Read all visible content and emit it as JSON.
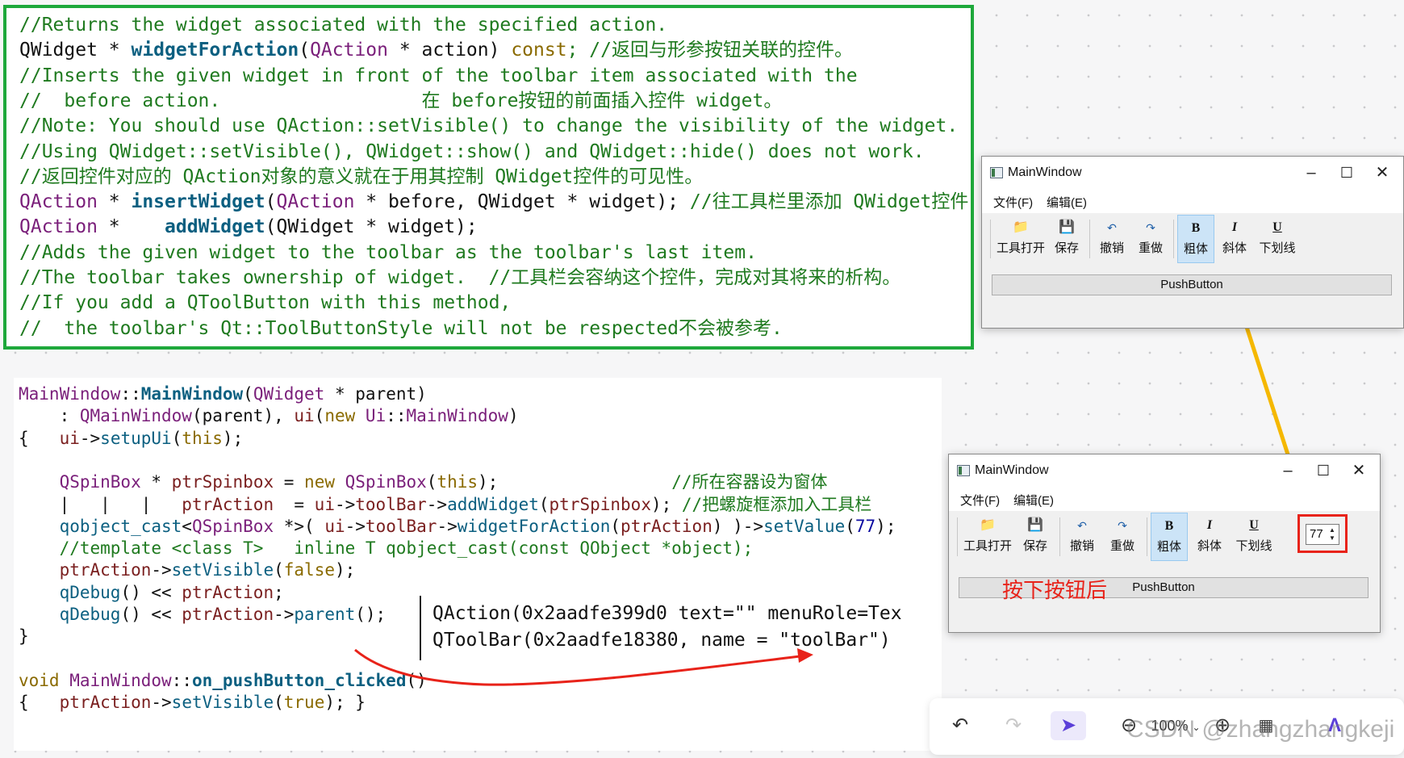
{
  "doc_lines": [
    [
      {
        "t": "//Returns the widget associated with the specified action.",
        "c": "cm"
      }
    ],
    [
      {
        "t": "QWidget ",
        "c": "tx"
      },
      {
        "t": "* ",
        "c": "tx"
      },
      {
        "t": "widgetForAction",
        "c": "fn"
      },
      {
        "t": "(",
        "c": "tx"
      },
      {
        "t": "QAction",
        "c": "ty"
      },
      {
        "t": " * action) ",
        "c": "tx"
      },
      {
        "t": "const",
        "c": "kw"
      },
      {
        "t": "; //返回与形参按钮关联的控件。",
        "c": "cm"
      }
    ],
    [
      {
        "t": "//Inserts the given widget in front of the toolbar item associated with the",
        "c": "cm"
      }
    ],
    [
      {
        "t": "//  before action.                  在 before按钮的前面插入控件 widget。",
        "c": "cm"
      }
    ],
    [
      {
        "t": "//Note: You should use QAction::setVisible() to change the visibility of the widget.",
        "c": "cm"
      }
    ],
    [
      {
        "t": "//Using QWidget::setVisible(), QWidget::show() and QWidget::hide() does not work.",
        "c": "cm"
      }
    ],
    [
      {
        "t": "//返回控件对应的 QAction对象的意义就在于用其控制 QWidget控件的可见性。",
        "c": "cm"
      }
    ],
    [
      {
        "t": "QAction",
        "c": "ty"
      },
      {
        "t": " * ",
        "c": "tx"
      },
      {
        "t": "insertWidget",
        "c": "fn"
      },
      {
        "t": "(",
        "c": "tx"
      },
      {
        "t": "QAction",
        "c": "ty"
      },
      {
        "t": " * before, QWidget * widget); ",
        "c": "tx"
      },
      {
        "t": "//往工具栏里添加 QWidget控件",
        "c": "cm"
      }
    ],
    [
      {
        "t": "QAction",
        "c": "ty"
      },
      {
        "t": " *    ",
        "c": "tx"
      },
      {
        "t": "addWidget",
        "c": "fn"
      },
      {
        "t": "(QWidget * widget);",
        "c": "tx"
      }
    ],
    [
      {
        "t": "//Adds the given widget to the toolbar as the toolbar's last item.",
        "c": "cm"
      }
    ],
    [
      {
        "t": "//The toolbar takes ownership of widget.  //工具栏会容纳这个控件，完成对其将来的析构。",
        "c": "cm"
      }
    ],
    [
      {
        "t": "//If you add a QToolButton with this method,",
        "c": "cm"
      }
    ],
    [
      {
        "t": "//  the toolbar's Qt::ToolButtonStyle will not be respected不会被参考.",
        "c": "cm"
      }
    ]
  ],
  "code_lines": [
    [
      {
        "t": "MainWindow",
        "c": "c-ty"
      },
      {
        "t": "::",
        "c": ""
      },
      {
        "t": "MainWindow",
        "c": "c-fn"
      },
      {
        "t": "(",
        "c": ""
      },
      {
        "t": "QWidget",
        "c": "c-ty"
      },
      {
        "t": " * ",
        "c": ""
      },
      {
        "t": "parent",
        "c": ""
      },
      {
        "t": ")",
        "c": ""
      }
    ],
    [
      {
        "t": "    : ",
        "c": ""
      },
      {
        "t": "QMainWindow",
        "c": "c-ty"
      },
      {
        "t": "(parent), ",
        "c": ""
      },
      {
        "t": "ui",
        "c": "c-var"
      },
      {
        "t": "(",
        "c": ""
      },
      {
        "t": "new",
        "c": "c-kw"
      },
      {
        "t": " ",
        "c": ""
      },
      {
        "t": "Ui",
        "c": "c-ty"
      },
      {
        "t": "::",
        "c": ""
      },
      {
        "t": "MainWindow",
        "c": "c-ty"
      },
      {
        "t": ")",
        "c": ""
      }
    ],
    [
      {
        "t": "{   ",
        "c": ""
      },
      {
        "t": "ui",
        "c": "c-var"
      },
      {
        "t": "->",
        "c": ""
      },
      {
        "t": "setupUi",
        "c": "c-fnn"
      },
      {
        "t": "(",
        "c": ""
      },
      {
        "t": "this",
        "c": "c-kw"
      },
      {
        "t": ");",
        "c": ""
      }
    ],
    [
      {
        "t": "",
        "c": ""
      }
    ],
    [
      {
        "t": "    ",
        "c": ""
      },
      {
        "t": "QSpinBox",
        "c": "c-ty"
      },
      {
        "t": " * ",
        "c": ""
      },
      {
        "t": "ptrSpinbox",
        "c": "c-var"
      },
      {
        "t": " = ",
        "c": ""
      },
      {
        "t": "new",
        "c": "c-kw"
      },
      {
        "t": " ",
        "c": ""
      },
      {
        "t": "QSpinBox",
        "c": "c-ty"
      },
      {
        "t": "(",
        "c": ""
      },
      {
        "t": "this",
        "c": "c-kw"
      },
      {
        "t": ");                 ",
        "c": ""
      },
      {
        "t": "//所在容器设为窗体",
        "c": "c-cm"
      }
    ],
    [
      {
        "t": "    |   |   |   ",
        "c": ""
      },
      {
        "t": "ptrAction",
        "c": "c-var"
      },
      {
        "t": "  = ",
        "c": ""
      },
      {
        "t": "ui",
        "c": "c-var"
      },
      {
        "t": "->",
        "c": ""
      },
      {
        "t": "toolBar",
        "c": "c-var"
      },
      {
        "t": "->",
        "c": ""
      },
      {
        "t": "addWidget",
        "c": "c-fnn"
      },
      {
        "t": "(",
        "c": ""
      },
      {
        "t": "ptrSpinbox",
        "c": "c-var"
      },
      {
        "t": "); ",
        "c": ""
      },
      {
        "t": "//把螺旋框添加入工具栏",
        "c": "c-cm"
      }
    ],
    [
      {
        "t": "    ",
        "c": ""
      },
      {
        "t": "qobject_cast",
        "c": "c-fnn"
      },
      {
        "t": "<",
        "c": ""
      },
      {
        "t": "QSpinBox",
        "c": "c-ty"
      },
      {
        "t": " *>( ",
        "c": ""
      },
      {
        "t": "ui",
        "c": "c-var"
      },
      {
        "t": "->",
        "c": ""
      },
      {
        "t": "toolBar",
        "c": "c-var"
      },
      {
        "t": "->",
        "c": ""
      },
      {
        "t": "widgetForAction",
        "c": "c-fnn"
      },
      {
        "t": "(",
        "c": ""
      },
      {
        "t": "ptrAction",
        "c": "c-var"
      },
      {
        "t": ") )->",
        "c": ""
      },
      {
        "t": "setValue",
        "c": "c-fnn"
      },
      {
        "t": "(",
        "c": ""
      },
      {
        "t": "77",
        "c": "c-num"
      },
      {
        "t": ");",
        "c": ""
      }
    ],
    [
      {
        "t": "    ",
        "c": ""
      },
      {
        "t": "//template <class T>   inline T qobject_cast(const QObject *object);",
        "c": "c-cm"
      }
    ],
    [
      {
        "t": "    ",
        "c": ""
      },
      {
        "t": "ptrAction",
        "c": "c-var"
      },
      {
        "t": "->",
        "c": ""
      },
      {
        "t": "setVisible",
        "c": "c-fnn"
      },
      {
        "t": "(",
        "c": ""
      },
      {
        "t": "false",
        "c": "c-kw"
      },
      {
        "t": ");",
        "c": ""
      }
    ],
    [
      {
        "t": "    ",
        "c": ""
      },
      {
        "t": "qDebug",
        "c": "c-fnn"
      },
      {
        "t": "() << ",
        "c": ""
      },
      {
        "t": "ptrAction",
        "c": "c-var"
      },
      {
        "t": ";",
        "c": ""
      }
    ],
    [
      {
        "t": "    ",
        "c": ""
      },
      {
        "t": "qDebug",
        "c": "c-fnn"
      },
      {
        "t": "() << ",
        "c": ""
      },
      {
        "t": "ptrAction",
        "c": "c-var"
      },
      {
        "t": "->",
        "c": ""
      },
      {
        "t": "parent",
        "c": "c-fnn"
      },
      {
        "t": "();",
        "c": ""
      }
    ],
    [
      {
        "t": "}",
        "c": ""
      }
    ],
    [
      {
        "t": "",
        "c": ""
      }
    ],
    [
      {
        "t": "void",
        "c": "c-kw"
      },
      {
        "t": " ",
        "c": ""
      },
      {
        "t": "MainWindow",
        "c": "c-ty"
      },
      {
        "t": "::",
        "c": ""
      },
      {
        "t": "on_pushButton_clicked",
        "c": "c-fn"
      },
      {
        "t": "()",
        "c": ""
      }
    ],
    [
      {
        "t": "{   ",
        "c": ""
      },
      {
        "t": "ptrAction",
        "c": "c-var"
      },
      {
        "t": "->",
        "c": ""
      },
      {
        "t": "setVisible",
        "c": "c-fnn"
      },
      {
        "t": "(",
        "c": ""
      },
      {
        "t": "true",
        "c": "c-kw"
      },
      {
        "t": "); }",
        "c": ""
      }
    ]
  ],
  "output": {
    "line1": "QAction(0x2aadfe399d0 text=\"\" menuRole=Tex",
    "line2": "QToolBar(0x2aadfe18380, name = \"toolBar\")"
  },
  "window1": {
    "title": "MainWindow",
    "menus": [
      "文件(F)",
      "编辑(E)"
    ],
    "tools": [
      {
        "label": "工具打开",
        "icon": "folder-icon"
      },
      {
        "label": "保存",
        "icon": "save-icon"
      },
      {
        "label": "撤销",
        "icon": "undo-icon"
      },
      {
        "label": "重做",
        "icon": "redo-icon"
      },
      {
        "label": "粗体",
        "icon": "bold-icon"
      },
      {
        "label": "斜体",
        "icon": "italic-icon"
      },
      {
        "label": "下划线",
        "icon": "underline-icon"
      }
    ],
    "push_button": "PushButton"
  },
  "window2": {
    "title": "MainWindow",
    "menus": [
      "文件(F)",
      "编辑(E)"
    ],
    "tools": [
      {
        "label": "工具打开",
        "icon": "folder-icon"
      },
      {
        "label": "保存",
        "icon": "save-icon"
      },
      {
        "label": "撤销",
        "icon": "undo-icon"
      },
      {
        "label": "重做",
        "icon": "redo-icon"
      },
      {
        "label": "粗体",
        "icon": "bold-icon"
      },
      {
        "label": "斜体",
        "icon": "italic-icon"
      },
      {
        "label": "下划线",
        "icon": "underline-icon"
      }
    ],
    "spin_value": "77",
    "annotation": "按下按钮后",
    "push_button": "PushButton"
  },
  "canvas_toolbar": {
    "zoom": "100%"
  },
  "watermark": "CSDN @zhangzhangkeji",
  "colors": {
    "green_border": "#1ea83b",
    "red_annotation": "#e8231a",
    "arrow_yellow": "#f5b800"
  }
}
